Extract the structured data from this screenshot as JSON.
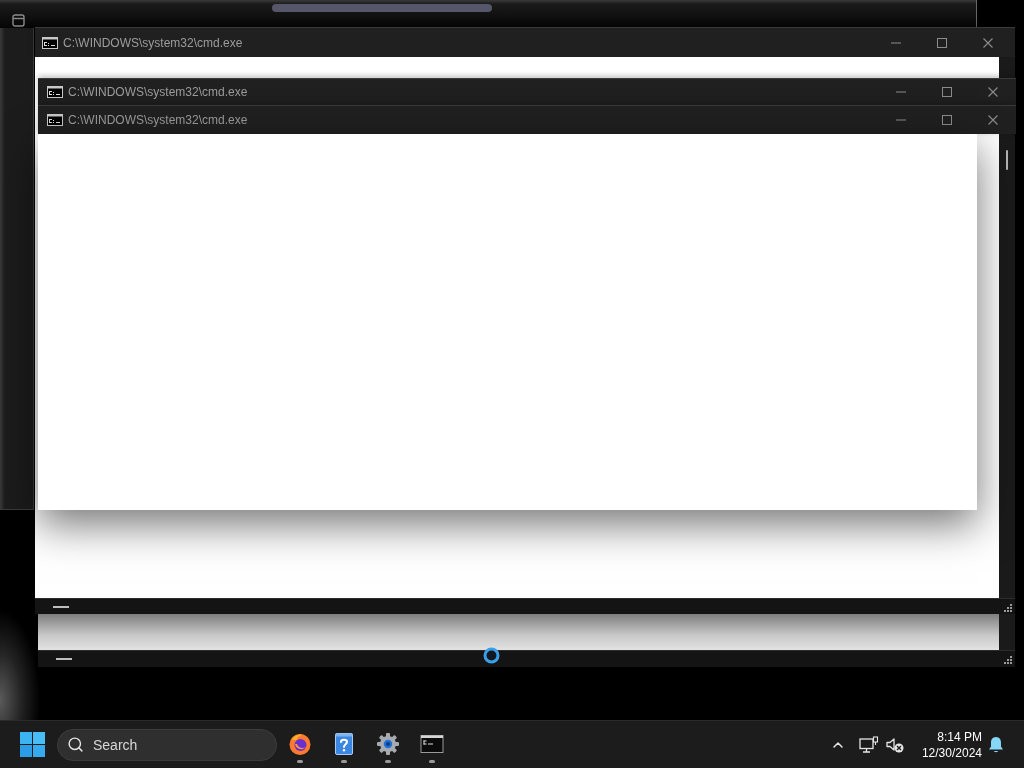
{
  "windows": [
    {
      "kind": "frame",
      "title": "C:\\WINDOWS\\system32\\cmd.exe"
    },
    {
      "kind": "titlebar",
      "title": "C:\\WINDOWS\\system32\\cmd.exe"
    },
    {
      "kind": "pane",
      "title": "C:\\WINDOWS\\system32\\cmd.exe"
    },
    {
      "kind": "strip"
    }
  ],
  "taskbar": {
    "search": {
      "placeholder": "Search"
    },
    "apps": [
      {
        "kind": "browser",
        "running": true
      },
      {
        "kind": "help",
        "running": true
      },
      {
        "kind": "settings",
        "running": true
      },
      {
        "kind": "terminal",
        "running": true
      }
    ],
    "clock": {
      "time": "8:14 PM",
      "date": "12/30/2024"
    }
  }
}
